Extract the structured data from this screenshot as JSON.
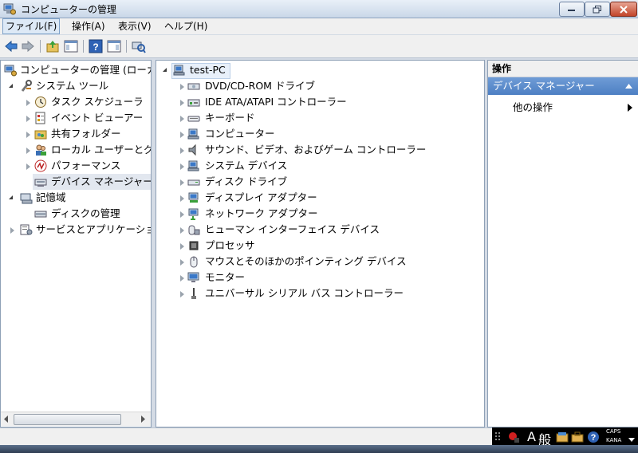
{
  "window": {
    "title": "コンピューターの管理",
    "icon": "computer-management-icon"
  },
  "menu": [
    {
      "label": "ファイル(F)"
    },
    {
      "label": "操作(A)"
    },
    {
      "label": "表示(V)"
    },
    {
      "label": "ヘルプ(H)"
    }
  ],
  "left_tree": {
    "root": "コンピューターの管理 (ローカ",
    "system_tools": "システム ツール",
    "items": [
      {
        "label": "タスク スケジューラ",
        "icon": "clock-icon"
      },
      {
        "label": "イベント ビューアー",
        "icon": "event-viewer-icon"
      },
      {
        "label": "共有フォルダー",
        "icon": "shared-folder-icon"
      },
      {
        "label": "ローカル ユーザーとグ",
        "icon": "users-icon"
      },
      {
        "label": "パフォーマンス",
        "icon": "performance-icon"
      },
      {
        "label": "デバイス マネージャー",
        "icon": "device-manager-icon"
      }
    ],
    "storage": "記憶域",
    "disk_mgmt": "ディスクの管理",
    "services": "サービスとアプリケーショ"
  },
  "device_tree": {
    "root": "test-PC",
    "devices": [
      {
        "label": "DVD/CD-ROM ドライブ",
        "icon": "dvd-drive-icon"
      },
      {
        "label": "IDE ATA/ATAPI コントローラー",
        "icon": "ide-controller-icon"
      },
      {
        "label": "キーボード",
        "icon": "keyboard-icon"
      },
      {
        "label": "コンピューター",
        "icon": "computer-icon"
      },
      {
        "label": "サウンド、ビデオ、およびゲーム コントローラー",
        "icon": "speaker-icon"
      },
      {
        "label": "システム デバイス",
        "icon": "system-device-icon"
      },
      {
        "label": "ディスク ドライブ",
        "icon": "disk-drive-icon"
      },
      {
        "label": "ディスプレイ アダプター",
        "icon": "display-adapter-icon"
      },
      {
        "label": "ネットワーク アダプター",
        "icon": "network-adapter-icon"
      },
      {
        "label": "ヒューマン インターフェイス デバイス",
        "icon": "hid-icon"
      },
      {
        "label": "プロセッサ",
        "icon": "processor-icon"
      },
      {
        "label": "マウスとそのほかのポインティング デバイス",
        "icon": "mouse-icon"
      },
      {
        "label": "モニター",
        "icon": "monitor-icon"
      },
      {
        "label": "ユニバーサル シリアル バス コントローラー",
        "icon": "usb-icon"
      }
    ]
  },
  "actions": {
    "header": "操作",
    "section": "デバイス マネージャー",
    "more": "他の操作"
  },
  "tray": {
    "ime_mode": "A",
    "ime_label": "般",
    "caps": "CAPS",
    "kana": "KANA"
  },
  "colors": {
    "accent": "#4d7fc3",
    "selection": "#e2e7ef"
  }
}
